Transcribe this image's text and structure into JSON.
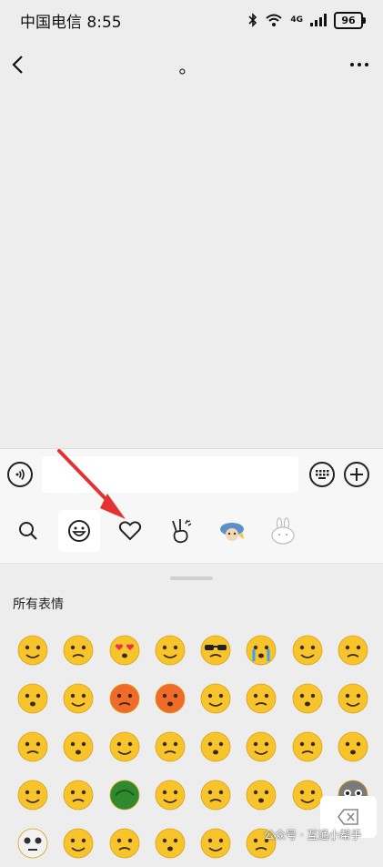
{
  "status": {
    "carrier_time": "中国电信 8:55",
    "network": "4G",
    "battery": "96"
  },
  "nav": {
    "title": "。"
  },
  "input": {
    "value": "",
    "placeholder": ""
  },
  "tabs": [
    {
      "id": "search",
      "icon": "search-icon"
    },
    {
      "id": "emoji",
      "icon": "smiley-icon",
      "active": true
    },
    {
      "id": "favorites",
      "icon": "heart-icon"
    },
    {
      "id": "sticker-hand",
      "icon": "victory-hand-icon"
    },
    {
      "id": "sticker-pack",
      "icon": "sticker-pack-icon"
    },
    {
      "id": "sticker-rabbit",
      "icon": "rabbit-icon"
    }
  ],
  "panel": {
    "title": "所有表情"
  },
  "emojis": [
    "smile",
    "worried",
    "heart-eyes",
    "shocked",
    "cool",
    "crying",
    "sleepy",
    "mouth-zipped",
    "zzz",
    "angry-tears",
    "blushing",
    "furious",
    "wink",
    "grin",
    "awkward",
    "sad",
    "surprised",
    "laughing",
    "sick",
    "covering-mouth",
    "happy",
    "shy",
    "frown",
    "skeptical",
    "mad",
    "excited",
    "turtle",
    "evil-grin",
    "question",
    "shush",
    "dizzy",
    "ghost",
    "skull",
    "busy",
    "thinking",
    "sweat",
    "pouting",
    "face-palm"
  ],
  "watermark": "公众号 · 互通小帮手",
  "colors": {
    "emoji_yellow": "#f8c42c",
    "annotation_arrow": "#e53131"
  }
}
